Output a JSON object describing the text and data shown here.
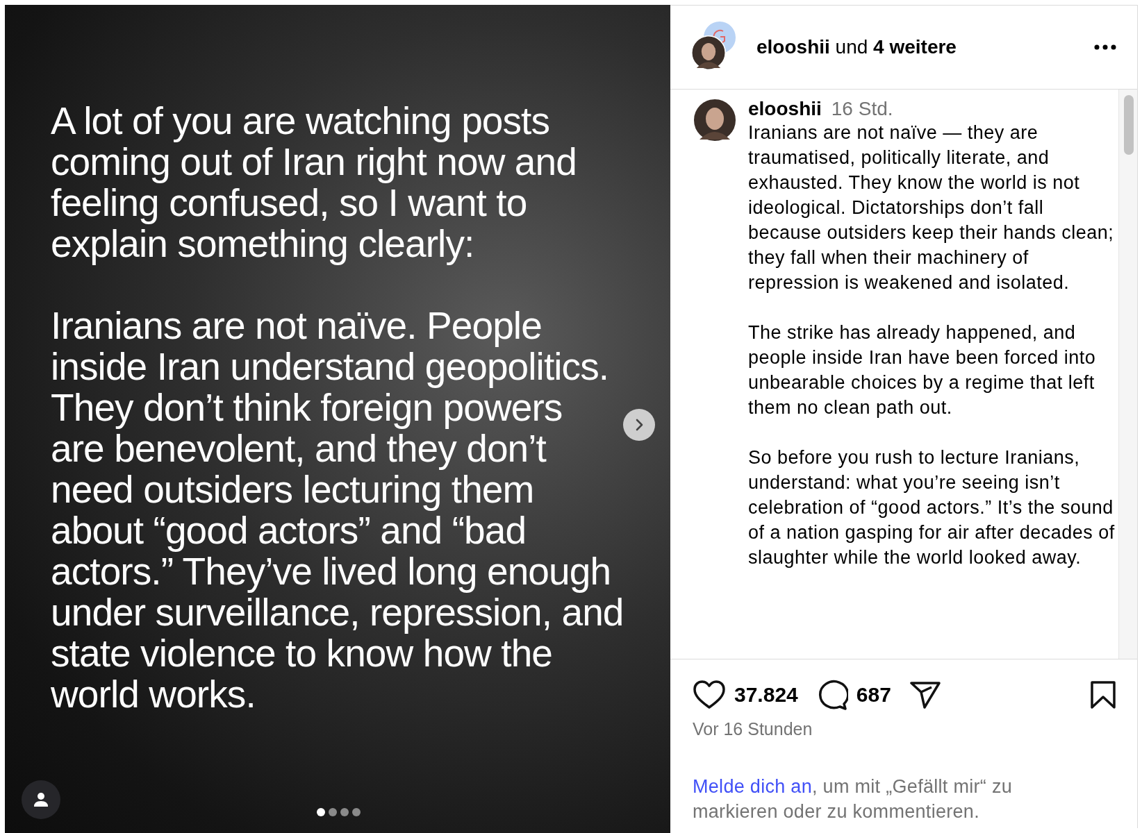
{
  "slide": {
    "paragraphs": [
      "A lot of you are watching posts coming out of Iran right now and feeling confused, so I want to explain something clearly:",
      "Iranians are not naïve. People inside Iran understand geopolitics. They don’t think foreign powers are benevolent, and they don’t need outsiders lecturing them about “good actors” and “bad actors.” They’ve lived long enough under surveillance, repression, and state violence to know how the world works."
    ],
    "dots": [
      {
        "selected": true
      },
      {
        "selected": false
      },
      {
        "selected": false
      },
      {
        "selected": false
      }
    ]
  },
  "header": {
    "title": "**elooshii** und **4 weitere**"
  },
  "caption": {
    "username": "elooshii",
    "time": "16 Std.",
    "paragraphs": [
      "Iranians are not naïve — they are traumatised, politically literate, and exhausted. They know the world is not ideological. Dictatorships don’t fall because outsiders keep their hands clean; they fall when their machinery of repression is weakened and isolated.",
      "The strike has already happened, and people inside Iran have been forced into unbearable choices by a regime that left them no clean path out.",
      "So before you rush to lecture Iranians, understand: what you’re seeing isn’t celebration of “good actors.” It’s the sound of a nation gasping for air after decades of slaughter while the world looked away."
    ]
  },
  "actions": {
    "likes": "37.824",
    "comments": "687",
    "time": "Vor 16 Stunden"
  },
  "login": {
    "link": "Melde dich an",
    "text": ", um mit „Gefällt mir“ zu markieren oder zu kommentieren."
  }
}
